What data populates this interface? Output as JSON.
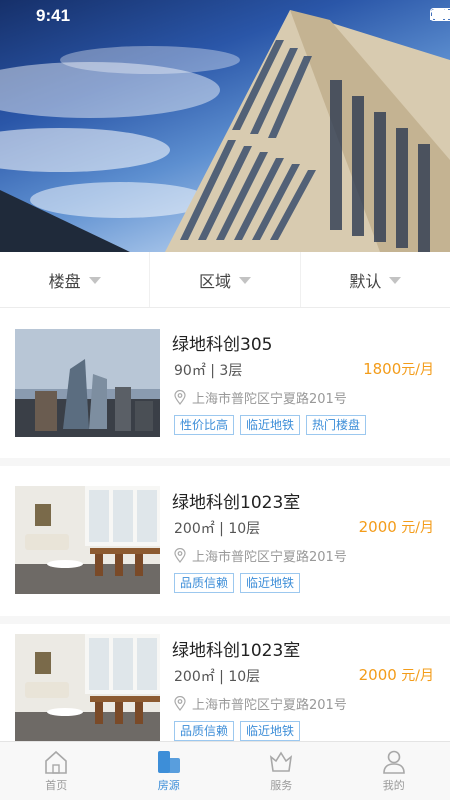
{
  "status_bar": {
    "time": "9:41"
  },
  "filters": [
    {
      "label": "楼盘"
    },
    {
      "label": "区域"
    },
    {
      "label": "默认"
    }
  ],
  "listings": [
    {
      "title": "绿地科创305",
      "area": "90㎡ | 3层",
      "price": "1800",
      "price_unit": "元/月",
      "address": "上海市普陀区宁夏路201号",
      "tags": [
        "性价比高",
        "临近地铁",
        "热门楼盘"
      ]
    },
    {
      "title": "绿地科创1023室",
      "area": "200㎡ | 10层",
      "price": "2000",
      "price_unit": " 元/月",
      "address": "上海市普陀区宁夏路201号",
      "tags": [
        "品质信赖",
        "临近地铁"
      ]
    },
    {
      "title": "绿地科创1023室",
      "area": "200㎡ | 10层",
      "price": "2000",
      "price_unit": " 元/月",
      "address": "上海市普陀区宁夏路201号",
      "tags": [
        "品质信赖",
        "临近地铁"
      ]
    }
  ],
  "tabbar": [
    {
      "label": "首页",
      "icon": "home-icon",
      "active": false
    },
    {
      "label": "房源",
      "icon": "building-icon",
      "active": true
    },
    {
      "label": "服务",
      "icon": "service-icon",
      "active": false
    },
    {
      "label": "我的",
      "icon": "profile-icon",
      "active": false
    }
  ],
  "colors": {
    "accent": "#3d8ed8",
    "price": "#f39c1a",
    "tag_border": "#9cc8ef"
  }
}
